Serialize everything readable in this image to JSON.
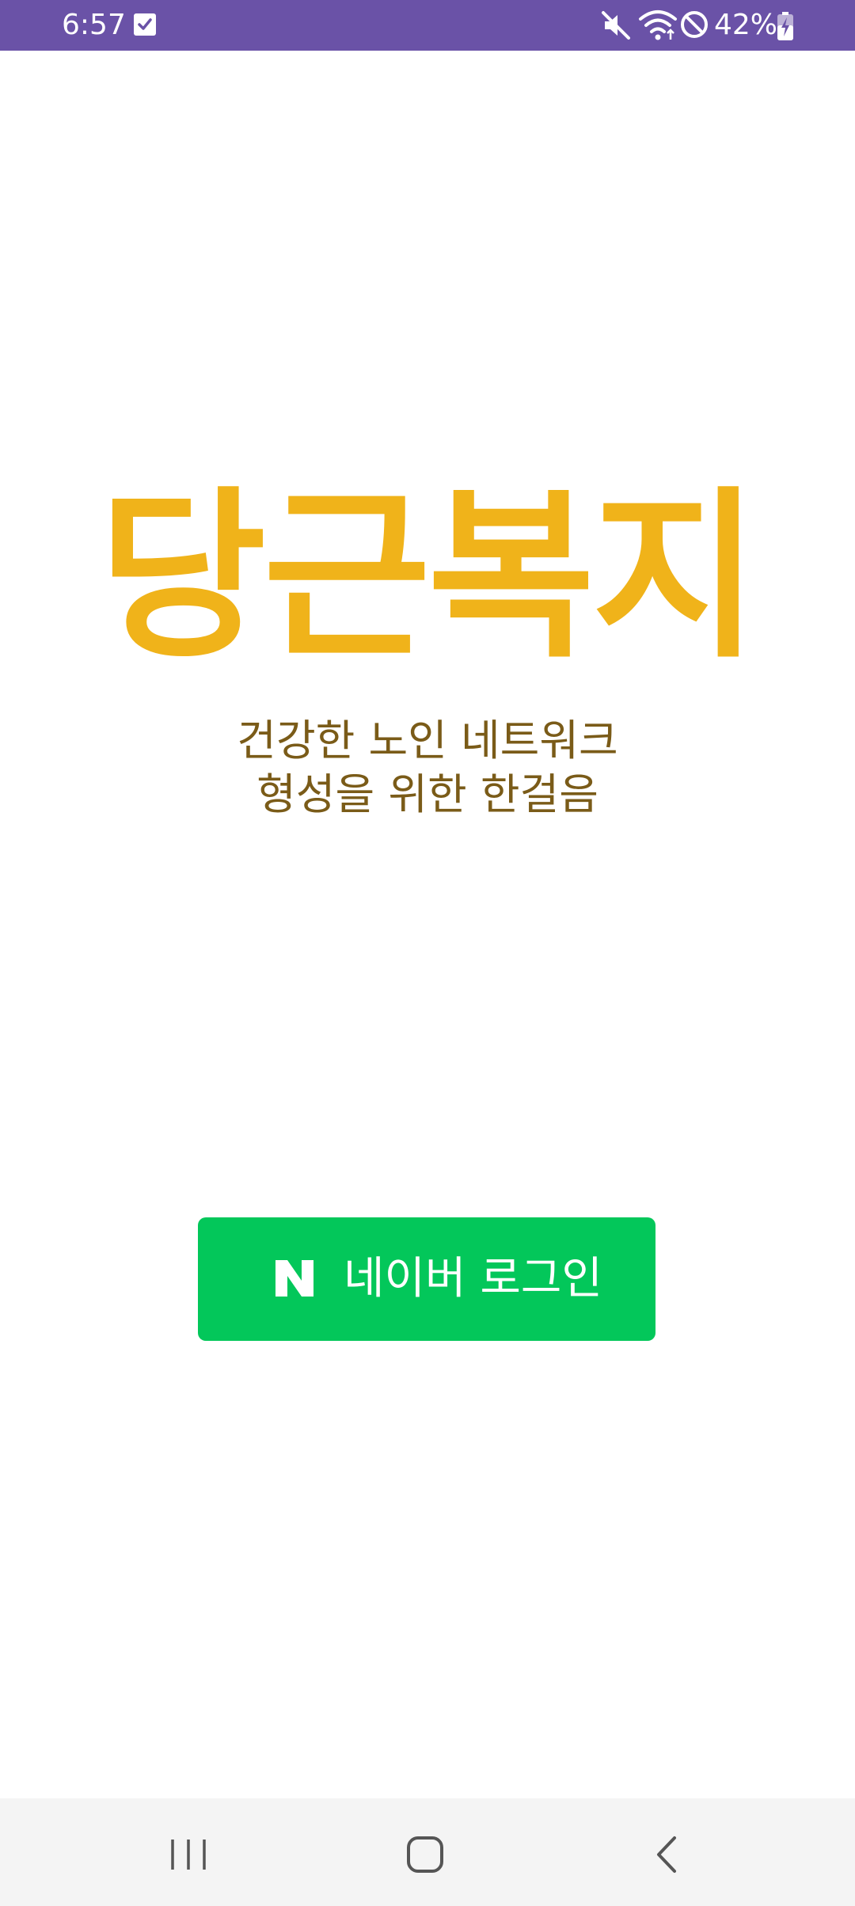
{
  "status_bar": {
    "time": "6:57",
    "battery_percent": "42%",
    "background_color": "#6a52a7",
    "icons": [
      "checklist-notification-icon",
      "mute-icon",
      "wifi-icon",
      "do-not-disturb-icon",
      "battery-charging-icon"
    ]
  },
  "app": {
    "title": "당근복지",
    "tagline_line1": "건강한 노인 네트워크",
    "tagline_line2": "형성을 위한 한걸음",
    "title_color": "#f0b31a",
    "tagline_color": "#7a5b18"
  },
  "login": {
    "naver_button_label": "네이버 로그인",
    "button_color": "#03c75a",
    "logo_icon": "naver-n-icon"
  },
  "nav_bar": {
    "icons": [
      "recents-icon",
      "home-icon",
      "back-icon"
    ]
  }
}
